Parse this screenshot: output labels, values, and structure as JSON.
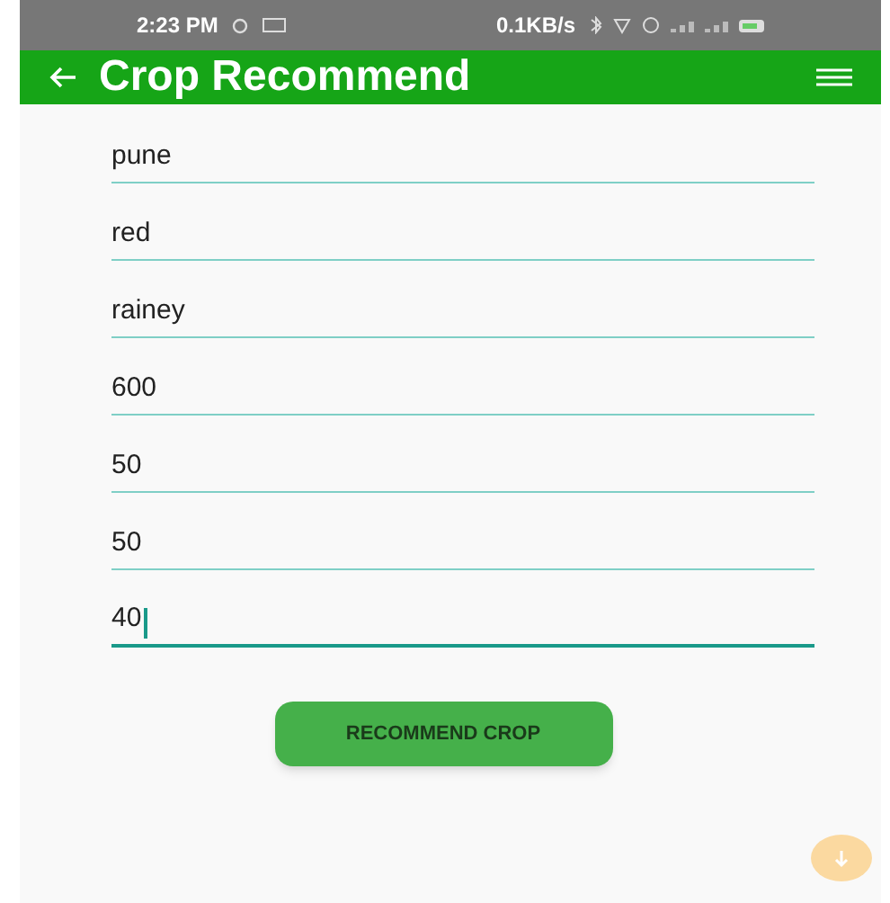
{
  "status_bar": {
    "time": "2:23 PM",
    "speed": "0.1KB/s"
  },
  "app_bar": {
    "title": "Crop Recommend"
  },
  "fields": [
    {
      "value": "pune",
      "focused": false
    },
    {
      "value": "red",
      "focused": false
    },
    {
      "value": "rainey",
      "focused": false
    },
    {
      "value": "600",
      "focused": false
    },
    {
      "value": "50",
      "focused": false
    },
    {
      "value": "50",
      "focused": false
    },
    {
      "value": "40",
      "focused": true
    }
  ],
  "button": {
    "label": "RECOMMEND CROP"
  }
}
